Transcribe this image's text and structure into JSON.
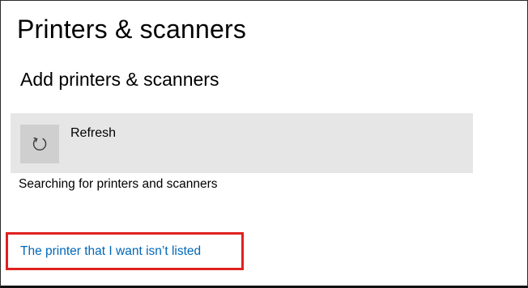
{
  "page": {
    "title": "Printers & scanners"
  },
  "add_section": {
    "title": "Add printers & scanners",
    "refresh": {
      "label": "Refresh",
      "icon": "refresh-icon"
    },
    "status": "Searching for printers and scanners",
    "link": {
      "label": "The printer that I want isn’t listed",
      "color": "#0067b8"
    }
  },
  "highlight": {
    "color": "#e02020"
  }
}
